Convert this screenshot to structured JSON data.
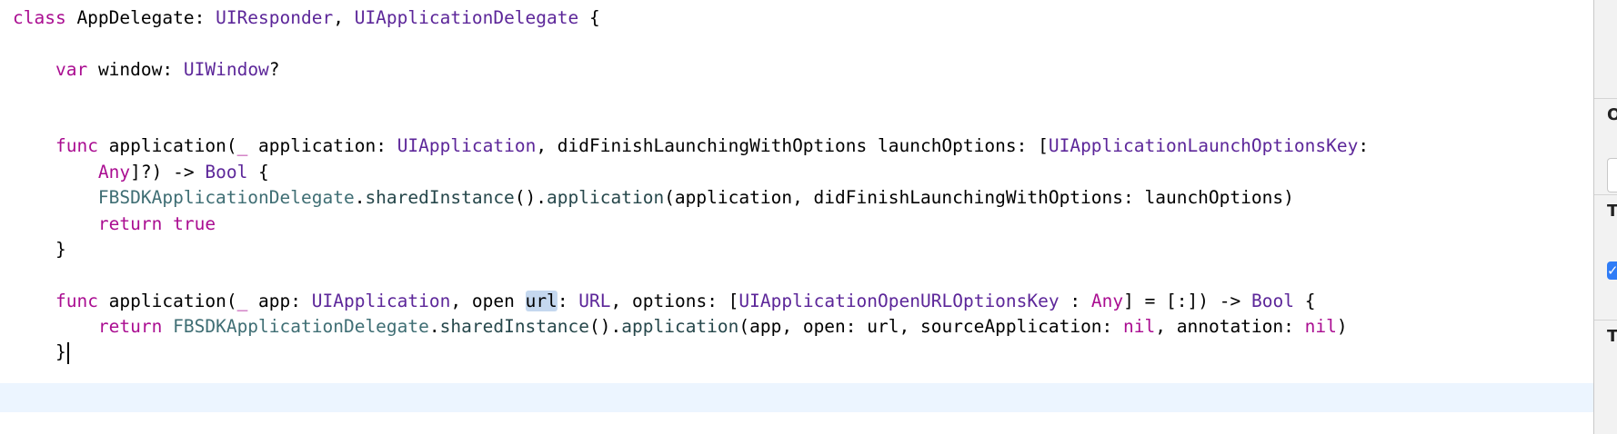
{
  "editor": {
    "lines": [
      {
        "tokens": [
          {
            "t": "class",
            "k": "kw"
          },
          {
            "t": " AppDelegate: "
          },
          {
            "t": "UIResponder",
            "k": "type"
          },
          {
            "t": ", "
          },
          {
            "t": "UIApplicationDelegate",
            "k": "type"
          },
          {
            "t": " {"
          }
        ]
      },
      {
        "tokens": [
          {
            "t": "    "
          },
          {
            "t": "var",
            "k": "kw"
          },
          {
            "t": " window: "
          },
          {
            "t": "UIWindow",
            "k": "type"
          },
          {
            "t": "?"
          }
        ]
      },
      {
        "tokens": [
          {
            "t": "    "
          },
          {
            "t": "func",
            "k": "kw"
          },
          {
            "t": " application("
          },
          {
            "t": "_",
            "k": "kw"
          },
          {
            "t": " application: "
          },
          {
            "t": "UIApplication",
            "k": "type"
          },
          {
            "t": ", didFinishLaunchingWithOptions launchOptions: ["
          },
          {
            "t": "UIApplicationLaunchOptionsKey",
            "k": "type"
          },
          {
            "t": ":"
          }
        ]
      },
      {
        "tokens": [
          {
            "t": "        "
          },
          {
            "t": "Any",
            "k": "kw"
          },
          {
            "t": "]?) -> "
          },
          {
            "t": "Bool",
            "k": "type"
          },
          {
            "t": " {"
          }
        ]
      },
      {
        "tokens": [
          {
            "t": "        "
          },
          {
            "t": "FBSDKApplicationDelegate",
            "k": "proj"
          },
          {
            "t": "."
          },
          {
            "t": "sharedInstance",
            "k": "call"
          },
          {
            "t": "()."
          },
          {
            "t": "application",
            "k": "call"
          },
          {
            "t": "(application, didFinishLaunchingWithOptions: launchOptions)"
          }
        ]
      },
      {
        "tokens": [
          {
            "t": "        "
          },
          {
            "t": "return",
            "k": "kw"
          },
          {
            "t": " "
          },
          {
            "t": "true",
            "k": "kw"
          }
        ]
      },
      {
        "tokens": [
          {
            "t": "    }"
          }
        ]
      },
      {
        "tokens": [
          {
            "t": "    "
          },
          {
            "t": "func",
            "k": "kw"
          },
          {
            "t": " application("
          },
          {
            "t": "_",
            "k": "kw"
          },
          {
            "t": " app: "
          },
          {
            "t": "UIApplication",
            "k": "type"
          },
          {
            "t": ", open "
          },
          {
            "t": "url",
            "k": "hl"
          },
          {
            "t": ": "
          },
          {
            "t": "URL",
            "k": "type"
          },
          {
            "t": ", options: ["
          },
          {
            "t": "UIApplicationOpenURLOptionsKey",
            "k": "type"
          },
          {
            "t": " : "
          },
          {
            "t": "Any",
            "k": "kw"
          },
          {
            "t": "] = [:]) -> "
          },
          {
            "t": "Bool",
            "k": "type"
          },
          {
            "t": " {"
          }
        ]
      },
      {
        "tokens": [
          {
            "t": "        "
          },
          {
            "t": "return",
            "k": "kw"
          },
          {
            "t": " "
          },
          {
            "t": "FBSDKApplicationDelegate",
            "k": "proj"
          },
          {
            "t": "."
          },
          {
            "t": "sharedInstance",
            "k": "call"
          },
          {
            "t": "()."
          },
          {
            "t": "application",
            "k": "call"
          },
          {
            "t": "(app, open: url, sourceApplication: "
          },
          {
            "t": "nil",
            "k": "kw"
          },
          {
            "t": ", annotation: "
          },
          {
            "t": "nil",
            "k": "kw"
          },
          {
            "t": ")"
          }
        ]
      },
      {
        "tokens": [
          {
            "t": "    }"
          }
        ]
      }
    ]
  },
  "inspector": {
    "label_1": "O",
    "label_2": "T",
    "label_3": "T",
    "checkbox_checked": true
  },
  "colors": {
    "keyword": "#aa0d91",
    "type": "#5c2699",
    "project": "#3f6e74",
    "call": "#26474b",
    "current_line": "#ecf5ff",
    "selection_highlight": "#c5d8ef"
  }
}
